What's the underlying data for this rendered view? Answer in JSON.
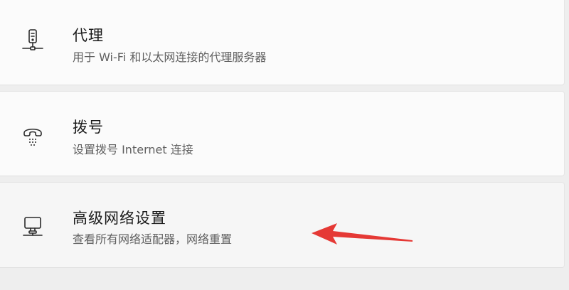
{
  "items": [
    {
      "icon": "proxy-server-icon",
      "title": "代理",
      "subtitle": "用于 Wi-Fi 和以太网连接的代理服务器"
    },
    {
      "icon": "dialup-phone-icon",
      "title": "拨号",
      "subtitle": "设置拨号 Internet 连接"
    },
    {
      "icon": "network-computer-icon",
      "title": "高级网络设置",
      "subtitle": "查看所有网络适配器，网络重置"
    }
  ],
  "colors": {
    "card_background": "#fbfbfb",
    "page_background": "#eeeeee",
    "title_text": "#1b1b1b",
    "subtitle_text": "#5f5f5f",
    "annotation_arrow": "#e53935"
  }
}
